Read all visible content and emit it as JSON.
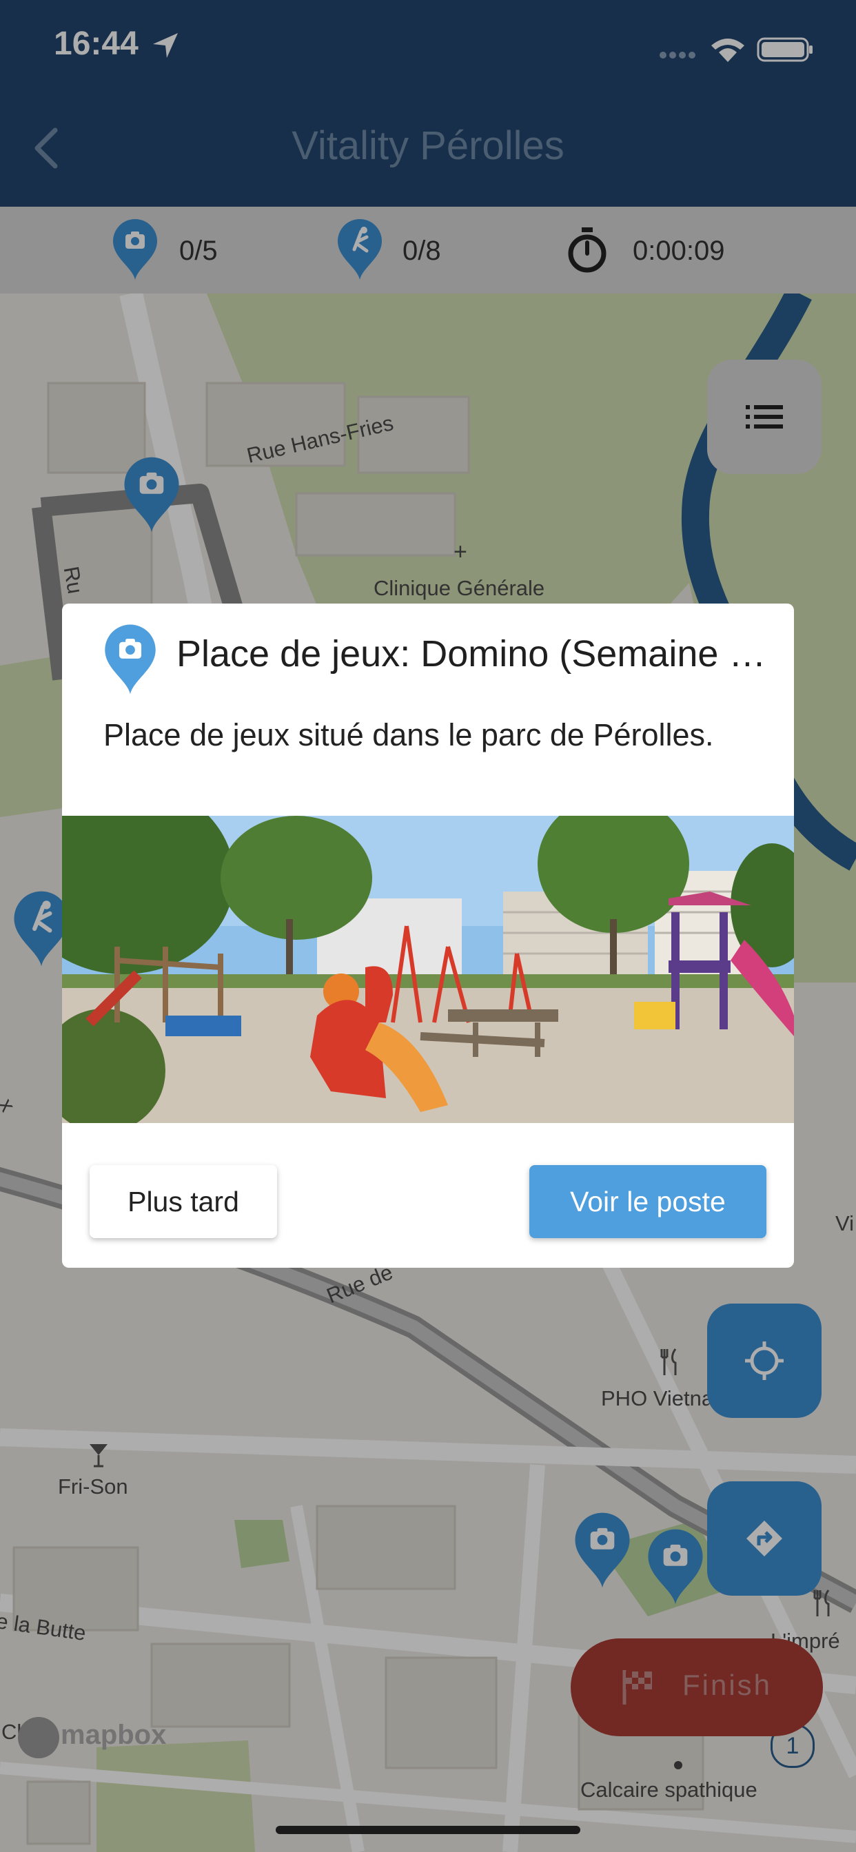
{
  "status_bar": {
    "time": "16:44"
  },
  "nav": {
    "title": "Vitality Pérolles"
  },
  "stats": {
    "photos": "0/5",
    "quiz": "0/8",
    "timer": "0:00:09"
  },
  "map": {
    "labels": {
      "street1": "Rue Hans-Fries",
      "clinic": "Clinique Générale",
      "street2": "Rue de",
      "pho": "PHO Vietna",
      "frison": "Fri-Son",
      "butte": "e la Butte",
      "impr": "L'impré",
      "calcaire": "Calcaire spathique",
      "vi": "Vi",
      "ru": "Ru",
      "x": "x",
      "cl": "Cl",
      "mapbox": "mapbox",
      "badge": "1"
    }
  },
  "dialog": {
    "title": "Place de jeux: Domino (Semaine de la mobilité)",
    "description": "Place de jeux situé dans le parc de Pérolles.",
    "later_button": "Plus tard",
    "see_button": "Voir le poste"
  },
  "finish": {
    "label": "Finish"
  },
  "colors": {
    "header": "#22466d",
    "accent": "#4f9edd",
    "finish": "#a93b34",
    "marker": "#3d8fd1"
  }
}
